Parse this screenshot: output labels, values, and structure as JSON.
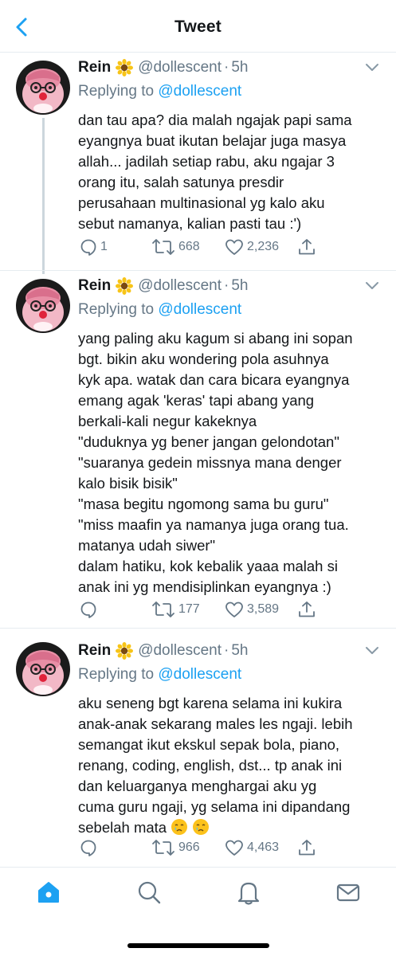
{
  "header": {
    "title": "Tweet"
  },
  "icons": {
    "back": "chevron-left-icon",
    "caret": "chevron-down-icon",
    "reply": "speech-bubble-icon",
    "retweet": "retweet-icon",
    "like": "heart-icon",
    "share": "share-icon"
  },
  "colors": {
    "accent": "#1da1f2",
    "secondary_text": "#657786",
    "divider": "#e6ecf0"
  },
  "tweets": [
    {
      "name": "Rein",
      "handle": "@dollescent",
      "dot": "·",
      "time": "5h",
      "replying_prefix": "Replying to",
      "replying_handle": "@dollescent",
      "text": "dan tau apa? dia malah ngajak papi sama\neyangnya buat ikutan belajar juga masya\nallah... jadilah setiap rabu, aku ngajar 3\norang itu, salah satunya presdir\nperusahaan multinasional yg kalo aku\nsebut namanya, kalian pasti tau :')",
      "replies": "1",
      "retweets": "668",
      "likes": "2,236"
    },
    {
      "name": "Rein",
      "handle": "@dollescent",
      "dot": "·",
      "time": "5h",
      "replying_prefix": "Replying to",
      "replying_handle": "@dollescent",
      "text": "yang paling aku kagum si abang ini sopan\nbgt. bikin aku wondering pola asuhnya\nkyk apa. watak dan cara bicara eyangnya\nemang agak 'keras' tapi abang yang\nberkali-kali negur kakeknya\n\"duduknya yg bener jangan gelondotan\"\n\"suaranya gedein missnya mana denger\nkalo bisik bisik\"\n\"masa begitu ngomong sama bu guru\"\n\"miss maafin ya namanya juga orang tua.\nmatanya udah siwer\"\ndalam hatiku, kok kebalik yaaa malah si\nanak ini yg mendisiplinkan eyangnya :)",
      "replies": "",
      "retweets": "177",
      "likes": "3,589"
    },
    {
      "name": "Rein",
      "handle": "@dollescent",
      "dot": "·",
      "time": "5h",
      "replying_prefix": "Replying to",
      "replying_handle": "@dollescent",
      "text": "aku seneng bgt karena selama ini kukira\nanak-anak sekarang males les ngaji. lebih\nsemangat ikut ekskul sepak bola, piano,\nrenang, coding, english, dst... tp anak ini\ndan keluarganya menghargai aku yg\ncuma guru ngaji, yg selama ini dipandang\nsebelah mata",
      "replies": "",
      "retweets": "966",
      "likes": "4,463"
    }
  ],
  "nav": [
    "home-icon",
    "search-icon",
    "bell-icon",
    "mail-icon"
  ]
}
